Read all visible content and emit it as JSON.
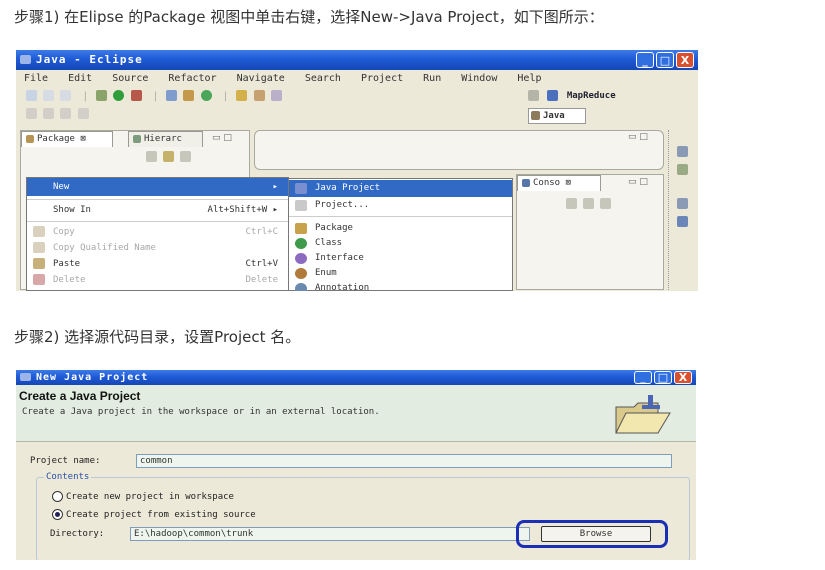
{
  "step1": {
    "text": "步骤1) 在Elipse 的Package 视图中单击右键，选择New->Java Project，如下图所示："
  },
  "step2": {
    "text": "步骤2) 选择源代码目录，设置Project 名。"
  },
  "eclipse": {
    "title": "Java - Eclipse",
    "window_buttons": {
      "minimize": "_",
      "maximize": "□",
      "close": "X"
    },
    "menu": [
      "File",
      "Edit",
      "Source",
      "Refactor",
      "Navigate",
      "Search",
      "Project",
      "Run",
      "Window",
      "Help"
    ],
    "perspectives": [
      "MapReduce",
      "Java"
    ],
    "views": {
      "package": "Package ⊠",
      "hierarchy": "Hierarc",
      "console": "Conso ⊠"
    },
    "context_menu": [
      {
        "label": "New",
        "shortcut": "▸",
        "state": "highlight"
      },
      {
        "label": "Show In",
        "shortcut": "Alt+Shift+W ▸",
        "state": "normal"
      },
      {
        "label": "Copy",
        "shortcut": "Ctrl+C",
        "state": "disabled"
      },
      {
        "label": "Copy Qualified Name",
        "shortcut": "",
        "state": "disabled"
      },
      {
        "label": "Paste",
        "shortcut": "Ctrl+V",
        "state": "normal"
      },
      {
        "label": "Delete",
        "shortcut": "Delete",
        "state": "disabled"
      }
    ],
    "submenu": [
      {
        "label": "Java Project",
        "state": "highlight",
        "icon_color": "#7a8fd0"
      },
      {
        "label": "Project...",
        "state": "normal",
        "icon_color": "#c9c9c9"
      },
      {
        "label": "Package",
        "state": "normal",
        "icon_color": "#c8a24a"
      },
      {
        "label": "Class",
        "state": "normal",
        "icon_color": "#3f9a4b"
      },
      {
        "label": "Interface",
        "state": "normal",
        "icon_color": "#8b6bbf"
      },
      {
        "label": "Enum",
        "state": "normal",
        "icon_color": "#b07a3a"
      },
      {
        "label": "Annotation",
        "state": "normal",
        "icon_color": "#6a8ab0"
      }
    ]
  },
  "wizard": {
    "title": "New Java Project",
    "heading": "Create a Java Project",
    "description": "Create a Java project in the workspace or in an external location.",
    "project_name_label": "Project name:",
    "project_name_value": "common",
    "contents_label": "Contents",
    "radio_new": "Create new project in workspace",
    "radio_existing": "Create project from existing source",
    "directory_label": "Directory:",
    "directory_value": "E:\\hadoop\\common\\trunk",
    "browse_label": "Browse",
    "highlight_color": "#1a2fb5"
  }
}
